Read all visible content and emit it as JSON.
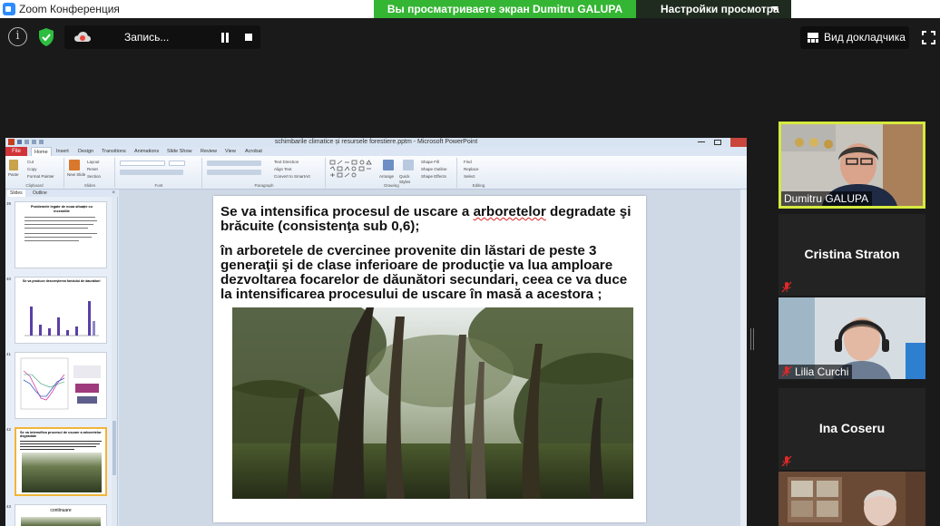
{
  "titlebar": {
    "app_title": "Zoom Конференция"
  },
  "share_banner": {
    "text": "Вы просматриваете экран Dumitru GALUPA"
  },
  "view_settings": {
    "label": "Настройки просмотра"
  },
  "top_controls": {
    "info_symbol": "i",
    "record_label": "Запись..."
  },
  "speaker_view": {
    "label": "Вид докладчика"
  },
  "colors": {
    "banner_green": "#35b534",
    "active_speaker_border": "#d5e93f",
    "ppt_file_tab": "#d13438",
    "muted_mic": "#e02828"
  },
  "powerpoint": {
    "window_title": "schimbarile climatice și resursele forestiere.pptm - Microsoft PowerPoint",
    "file_tab": "File",
    "tabs": [
      "Home",
      "Insert",
      "Design",
      "Transitions",
      "Animations",
      "Slide Show",
      "Review",
      "View",
      "Acrobat"
    ],
    "ribbon": {
      "clipboard": {
        "label": "Clipboard",
        "paste": "Paste",
        "cut": "Cut",
        "copy": "Copy",
        "format_painter": "Format Painter"
      },
      "slides": {
        "label": "Slides",
        "new_slide": "New Slide",
        "layout": "Layout",
        "reset": "Reset",
        "section": "Section"
      },
      "font": {
        "label": "Font"
      },
      "paragraph": {
        "label": "Paragraph",
        "text_direction": "Text Direction",
        "align_text": "Align Text",
        "convert_smartart": "Convert to SmartArt"
      },
      "drawing": {
        "label": "Drawing",
        "arrange": "Arrange",
        "quick_styles": "Quick Styles",
        "shape_fill": "Shape Fill",
        "shape_outline": "Shape Outline",
        "shape_effects": "Shape Effects"
      },
      "editing": {
        "label": "Editing",
        "find": "Find",
        "replace": "Replace",
        "select": "Select"
      }
    },
    "pane_tabs": {
      "slides": "Slides",
      "outline": "Outline"
    },
    "thumbnails": [
      {
        "number": "39",
        "title": "Problemele legate de noua situație cu incendiile"
      },
      {
        "number": "40",
        "title": "Se va produce descreșterea fondului de daunători"
      },
      {
        "number": "41",
        "title": ""
      },
      {
        "number": "42",
        "title": "Se va intensifica procesul de uscare a arboretelor degradate"
      },
      {
        "number": "43",
        "title": "continuare"
      }
    ],
    "slide": {
      "paragraph1_pre": "Se va intensifica procesul de uscare a ",
      "paragraph1_u": "arboretelor",
      "paragraph1_post": " degradate şi brăcuite (consistenţa sub 0,6);",
      "paragraph2": "în arboretele de cvercinee provenite din lăstari de peste 3 generaţii şi de clase inferioare de producţie  va lua amploare dezvoltarea focarelor de dăunători secundari, ceea ce va duce la intensificarea procesului de uscare în masă a acestora ;"
    }
  },
  "participants": [
    {
      "name": "Dumitru GALUPA",
      "video": true,
      "active": true,
      "muted": false
    },
    {
      "name": "Cristina Straton",
      "video": false,
      "active": false,
      "muted": true
    },
    {
      "name": "Lilia Curchi",
      "video": true,
      "active": false,
      "muted": true
    },
    {
      "name": "Ina Coseru",
      "video": false,
      "active": false,
      "muted": true
    },
    {
      "name": "",
      "video": true,
      "active": false,
      "muted": false
    }
  ]
}
